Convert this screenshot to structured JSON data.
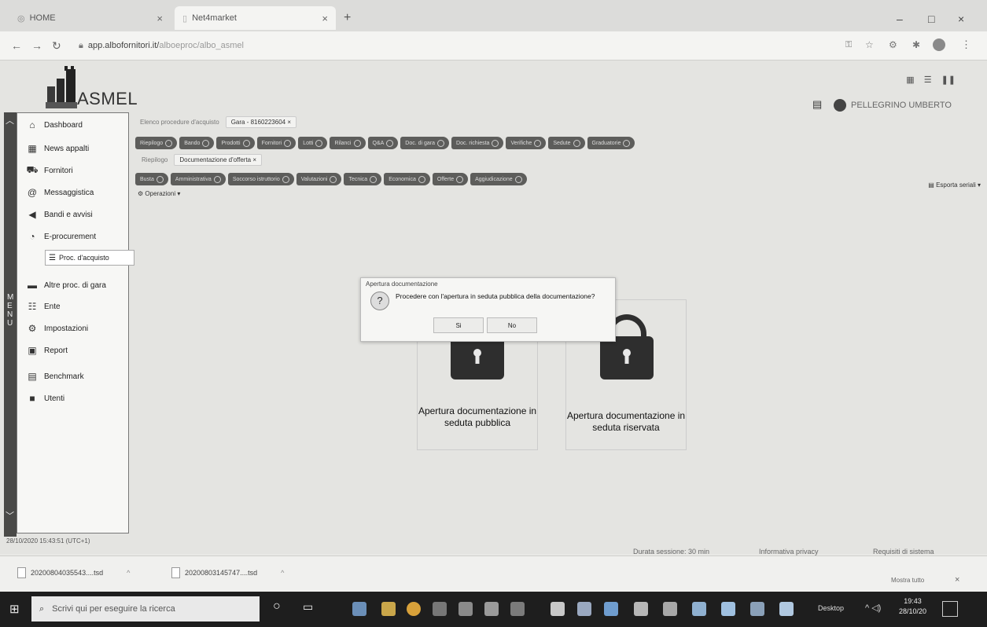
{
  "browser": {
    "tabs": [
      {
        "label": "HOME",
        "close": "×"
      },
      {
        "label": "Net4market",
        "close": "×"
      }
    ],
    "new_tab": "+",
    "url_host": "app.albofornitori.it/",
    "url_path": "alboeproc/albo_asmel",
    "window_controls": [
      "–",
      "□",
      "×"
    ]
  },
  "app": {
    "logo_text": "ASMEL",
    "user_name": "PELLEGRINO UMBERTO",
    "export_label": "Esporta seriali ▾",
    "operations_label": "Operazioni ▾",
    "breadcrumb1": "Elenco procedure d'acquisto",
    "gara_tag": "Gara - 8160223604 ×",
    "breadcrumb2": "Riepilogo",
    "doc_tag": "Documentazione d'offerta ×",
    "chips_row1": [
      "Riepilogo",
      "Bando",
      "Prodotti",
      "Fornitori",
      "Lotti",
      "Rilanci",
      "Q&A",
      "Doc. di gara",
      "Doc. richiesta",
      "Verifiche",
      "Sedute",
      "Graduatorie"
    ],
    "chips_row2": [
      "Busta",
      "Amministrativa",
      "Soccorso istruttorio",
      "Valutazioni",
      "Tecnica",
      "Economica",
      "Offerte",
      "Aggiudicazione"
    ],
    "sidebar": {
      "strip": "MENU",
      "items": [
        {
          "label": "Dashboard"
        },
        {
          "label": "News appalti"
        },
        {
          "label": "Fornitori"
        },
        {
          "label": "Messaggistica"
        },
        {
          "label": "Bandi e avvisi"
        },
        {
          "label": "E-procurement"
        },
        {
          "label": "Altre proc. di gara"
        },
        {
          "label": "Ente"
        },
        {
          "label": "Impostazioni"
        },
        {
          "label": "Report"
        },
        {
          "label": "Benchmark"
        },
        {
          "label": "Utenti"
        }
      ],
      "sub_item": "Proc. d'acquisto"
    },
    "cards": [
      {
        "label": "Apertura documentazione in seduta pubblica"
      },
      {
        "label": "Apertura documentazione in seduta riservata"
      }
    ],
    "dialog": {
      "title": "Apertura documentazione",
      "message": "Procedere con l'apertura in seduta pubblica della documentazione?",
      "yes": "Si",
      "no": "No"
    },
    "status_left": "28/10/2020 15:43:51 (UTC+1)",
    "footer_links": [
      "Durata sessione: 30 min",
      "Informativa privacy",
      "Requisiti di sistema"
    ]
  },
  "downloads": {
    "files": [
      "20200804035543....tsd",
      "20200803145747....tsd"
    ],
    "show_all": "Mostra tutto",
    "close": "×"
  },
  "taskbar": {
    "search_placeholder": "Scrivi qui per eseguire la ricerca",
    "desktop_label": "Desktop",
    "time": "19:43",
    "date": "28/10/20"
  }
}
